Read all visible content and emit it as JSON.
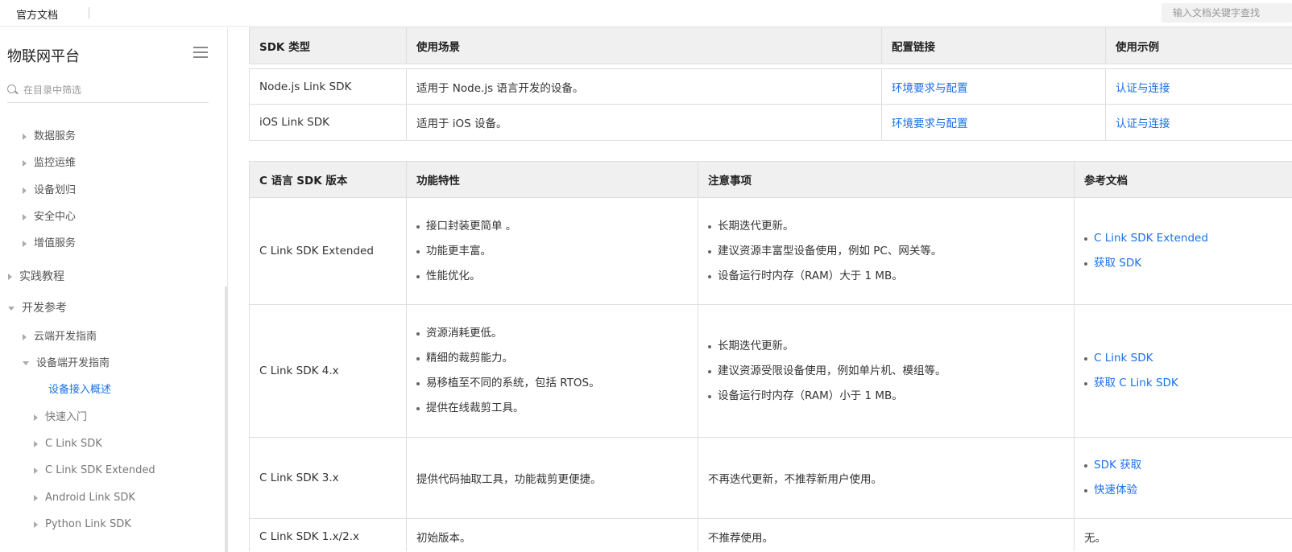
{
  "topbar": {
    "doc_link": "官方文档",
    "search_placeholder": "输入文档关键字查找"
  },
  "sidebar": {
    "title": "物联网平台",
    "filter_placeholder": "在目录中筛选",
    "items": [
      {
        "label": "数据服务",
        "arrow": "right"
      },
      {
        "label": "监控运维",
        "arrow": "right"
      },
      {
        "label": "设备划归",
        "arrow": "right"
      },
      {
        "label": "安全中心",
        "arrow": "right"
      },
      {
        "label": "增值服务",
        "arrow": "right"
      },
      {
        "label": "实践教程",
        "arrow": "right"
      },
      {
        "label": "开发参考",
        "arrow": "down"
      },
      {
        "label": "云端开发指南",
        "arrow": "right"
      },
      {
        "label": "设备端开发指南",
        "arrow": "down"
      },
      {
        "label": "设备接入概述",
        "arrow": "none"
      },
      {
        "label": "快速入门",
        "arrow": "right"
      },
      {
        "label": "C Link SDK",
        "arrow": "right"
      },
      {
        "label": "C Link SDK Extended",
        "arrow": "right"
      },
      {
        "label": "Android Link SDK",
        "arrow": "right"
      },
      {
        "label": "Python Link SDK",
        "arrow": "right"
      }
    ]
  },
  "table1": {
    "headers": [
      "SDK 类型",
      "使用场景",
      "配置链接",
      "使用示例"
    ],
    "rows": [
      {
        "type": "Node.js Link SDK",
        "scene": "适用于 Node.js 语言开发的设备。",
        "config": "环境要求与配置",
        "example": "认证与连接"
      },
      {
        "type": "iOS Link SDK",
        "scene": "适用于 iOS 设备。",
        "config": "环境要求与配置",
        "example": "认证与连接"
      }
    ]
  },
  "table2": {
    "headers": [
      "C 语言 SDK 版本",
      "功能特性",
      "注意事项",
      "参考文档"
    ],
    "rows": [
      {
        "version": "C Link SDK Extended",
        "features": [
          "接口封装更简单 。",
          "功能更丰富。",
          "性能优化。"
        ],
        "notes": [
          "长期迭代更新。",
          "建议资源丰富型设备使用，例如 PC、网关等。",
          "设备运行时内存（RAM）大于 1 MB。"
        ],
        "docs": [
          "C Link SDK Extended",
          "获取 SDK"
        ]
      },
      {
        "version": "C Link SDK 4.x",
        "features": [
          "资源消耗更低。",
          "精细的裁剪能力。",
          "易移植至不同的系统，包括 RTOS。",
          "提供在线裁剪工具。"
        ],
        "notes": [
          "长期迭代更新。",
          "建议资源受限设备使用，例如单片机、模组等。",
          "设备运行时内存（RAM）小于 1 MB。"
        ],
        "docs": [
          "C Link SDK",
          "获取 C Link SDK"
        ]
      },
      {
        "version": "C Link SDK 3.x",
        "feature_text": "提供代码抽取工具，功能裁剪更便捷。",
        "note_text": "不再迭代更新，不推荐新用户使用。",
        "docs": [
          "SDK 获取",
          "快速体验"
        ]
      },
      {
        "version": "C Link SDK 1.x/2.x",
        "feature_text": "初始版本。",
        "note_text": "不推荐使用。",
        "doc_text": "无。"
      }
    ]
  }
}
